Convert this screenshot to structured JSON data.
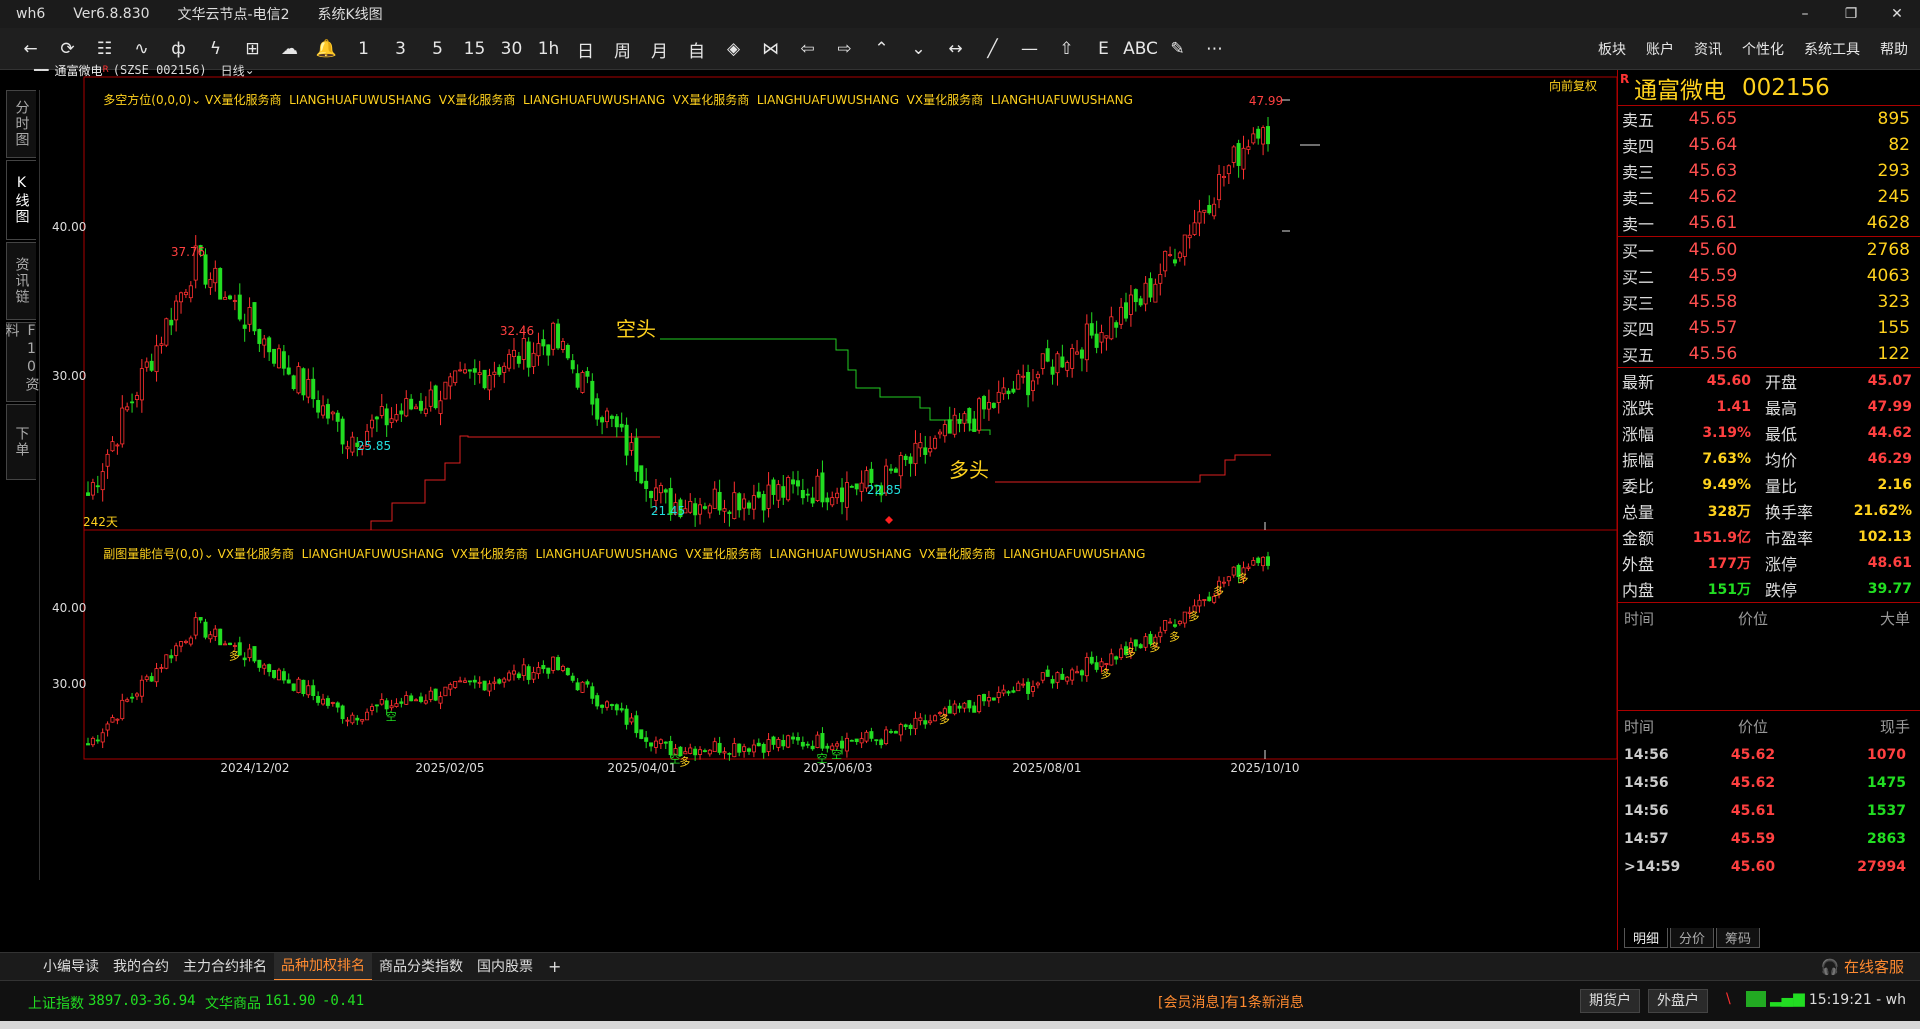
{
  "titlebar": {
    "app": "wh6",
    "version": "Ver6.8.830",
    "node": "文华云节点-电信2",
    "view": "系统K线图"
  },
  "window_controls": [
    "–",
    "❐",
    "✕"
  ],
  "toolbar": {
    "tools": [
      "←",
      "⟳",
      "☷",
      "∿",
      "ф",
      "ϟ",
      "⊞",
      "☁",
      "🔔",
      "1",
      "3",
      "5",
      "15",
      "30",
      "1h",
      "日",
      "周",
      "月",
      "自",
      "◈",
      "⋈",
      "⇦",
      "⇨",
      "⌃",
      "⌄",
      "↔",
      "╱",
      "—",
      "⇧",
      "Ε",
      "ABC",
      "✎",
      "⋯"
    ],
    "menus": [
      "板块",
      "账户",
      "资讯",
      "个性化",
      "系统工具",
      "帮助"
    ]
  },
  "left_tabs": [
    {
      "label": "分时图",
      "active": false
    },
    {
      "label": "K线图",
      "active": true
    },
    {
      "label": "资讯链",
      "active": false
    },
    {
      "label": "F10资料",
      "active": false
    },
    {
      "label": "下单",
      "active": false
    }
  ],
  "chart_header": {
    "name": "通富微电",
    "mark": "R",
    "exchange_code": "(SZSE 002156)",
    "period": "日线"
  },
  "main_chart": {
    "indicator": "多空方位(0,0,0)",
    "ad_text": "VX量化服务商  LIANGHUAFUWUSHANG  VX量化服务商  LIANGHUAFUWUSHANG  VX量化服务商  LIANGHUAFUWUSHANG  VX量化服务商  LIANGHUAFUWUSHANG",
    "adjust_label": "向前复权",
    "days_label": "242天",
    "bear_label": "空头",
    "bull_label": "多头"
  },
  "sub_chart": {
    "indicator": "副图量能信号(0,0)",
    "ad_text": "VX量化服务商  LIANGHUAFUWUSHANG  VX量化服务商  LIANGHUAFUWUSHANG  VX量化服务商  LIANGHUAFUWUSHANG  VX量化服务商  LIANGHUAFUWUSHANG",
    "bull_mark": "多",
    "bear_mark": "空"
  },
  "chart_data": {
    "type": "candlestick",
    "title": "通富微电 (SZSE 002156) 日线",
    "price_axis_ticks": [
      "40.00",
      "30.00"
    ],
    "sub_axis_ticks": [
      "40.00",
      "30.00"
    ],
    "date_ticks": [
      "2024/12/02",
      "2025/02/05",
      "2025/04/01",
      "2025/06/03",
      "2025/08/01",
      "2025/10/10"
    ],
    "annotations": [
      {
        "label": "37.76",
        "type": "high"
      },
      {
        "label": "32.46",
        "type": "high"
      },
      {
        "label": "25.85",
        "type": "low"
      },
      {
        "label": "21.45",
        "type": "low"
      },
      {
        "label": "22.85",
        "type": "low"
      },
      {
        "label": "47.99",
        "type": "high"
      }
    ],
    "key_points": [
      {
        "date": "2024/10/08",
        "price": 22.0
      },
      {
        "date": "2024/11/12",
        "price": 37.76
      },
      {
        "date": "2024/12/30",
        "price": 25.85
      },
      {
        "date": "2025/03/06",
        "price": 32.46
      },
      {
        "date": "2025/04/07",
        "price": 21.45
      },
      {
        "date": "2025/06/20",
        "price": 22.85
      },
      {
        "date": "2025/09/08",
        "price": 35.0
      },
      {
        "date": "2025/10/10",
        "price": 47.99
      }
    ]
  },
  "right_panel": {
    "mark": "R",
    "name": "通富微电",
    "code": "002156",
    "asks": [
      {
        "label": "卖五",
        "price": "45.65",
        "vol": "895"
      },
      {
        "label": "卖四",
        "price": "45.64",
        "vol": "82"
      },
      {
        "label": "卖三",
        "price": "45.63",
        "vol": "293"
      },
      {
        "label": "卖二",
        "price": "45.62",
        "vol": "245"
      },
      {
        "label": "卖一",
        "price": "45.61",
        "vol": "4628"
      }
    ],
    "bids": [
      {
        "label": "买一",
        "price": "45.60",
        "vol": "2768"
      },
      {
        "label": "买二",
        "price": "45.59",
        "vol": "4063"
      },
      {
        "label": "买三",
        "price": "45.58",
        "vol": "323"
      },
      {
        "label": "买四",
        "price": "45.57",
        "vol": "155"
      },
      {
        "label": "买五",
        "price": "45.56",
        "vol": "122"
      }
    ],
    "quote": [
      {
        "l1": "最新",
        "v1": "45.60",
        "c1": "red",
        "l2": "开盘",
        "v2": "45.07",
        "c2": "red"
      },
      {
        "l1": "涨跌",
        "v1": "1.41",
        "c1": "red",
        "l2": "最高",
        "v2": "47.99",
        "c2": "red"
      },
      {
        "l1": "涨幅",
        "v1": "3.19%",
        "c1": "red",
        "l2": "最低",
        "v2": "44.62",
        "c2": "red"
      },
      {
        "l1": "振幅",
        "v1": "7.63%",
        "c1": "yel",
        "l2": "均价",
        "v2": "46.29",
        "c2": "red"
      },
      {
        "l1": "委比",
        "v1": "9.49%",
        "c1": "yel",
        "l2": "量比",
        "v2": "2.16",
        "c2": "yel"
      },
      {
        "l1": "总量",
        "v1": "328万",
        "c1": "yel",
        "l2": "换手率",
        "v2": "21.62%",
        "c2": "yel"
      },
      {
        "l1": "金额",
        "v1": "151.9亿",
        "c1": "red",
        "l2": "市盈率",
        "v2": "102.13",
        "c2": "yel"
      },
      {
        "l1": "外盘",
        "v1": "177万",
        "c1": "red",
        "l2": "涨停",
        "v2": "48.61",
        "c2": "red"
      },
      {
        "l1": "内盘",
        "v1": "151万",
        "c1": "grn",
        "l2": "跌停",
        "v2": "39.77",
        "c2": "grn"
      }
    ],
    "big_header": [
      "时间",
      "价位",
      "大单"
    ],
    "tick_header": [
      "时间",
      "价位",
      "现手"
    ],
    "ticks": [
      {
        "time": "14:56",
        "price": "45.62",
        "vol": "1070",
        "c": "red"
      },
      {
        "time": "14:56",
        "price": "45.62",
        "vol": "1475",
        "c": "grn"
      },
      {
        "time": "14:56",
        "price": "45.61",
        "vol": "1537",
        "c": "grn"
      },
      {
        "time": "14:57",
        "price": "45.59",
        "vol": "2863",
        "c": "grn"
      },
      {
        "time": ">14:59",
        "price": "45.60",
        "vol": "27994",
        "c": "red"
      }
    ],
    "tabs": [
      "明细",
      "分价",
      "筹码"
    ]
  },
  "bottom_tabs": [
    {
      "label": "小编导读",
      "active": false
    },
    {
      "label": "我的合约",
      "active": false
    },
    {
      "label": "主力合约排名",
      "active": false
    },
    {
      "label": "品种加权排名",
      "active": true
    },
    {
      "label": "商品分类指数",
      "active": false
    },
    {
      "label": "国内股票",
      "active": false
    }
  ],
  "service": "在线客服",
  "status": {
    "idx1_name": "上证指数",
    "idx1_value": "3897.03",
    "idx1_change": "-36.94",
    "idx2_name": "文华商品",
    "idx2_value": "161.90",
    "idx2_change": "-0.41",
    "message": "[会员消息]有1条新消息",
    "btn1": "期货户",
    "btn2": "外盘户",
    "clock": "15:19:21 - wh"
  },
  "colors": {
    "up": "#ff3030",
    "down": "#22dd22",
    "accent": "#ffd21e",
    "grid_red": "#aa0000",
    "orange": "#ff8a30"
  }
}
